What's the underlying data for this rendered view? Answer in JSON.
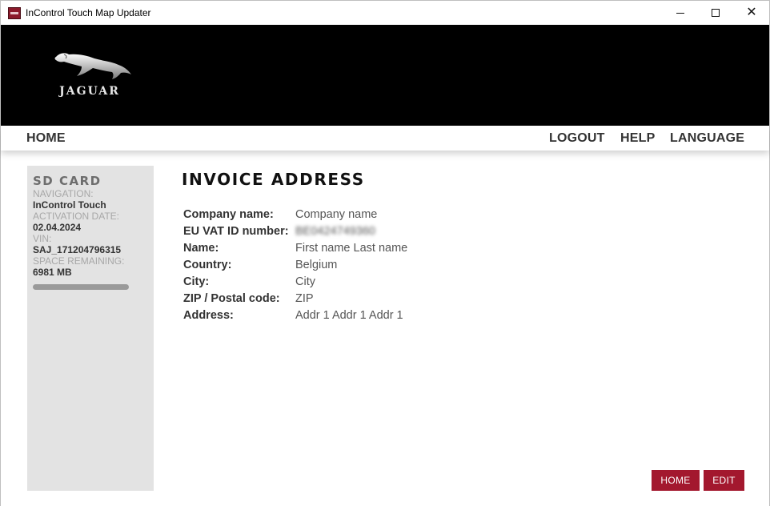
{
  "window": {
    "title": "InControl Touch Map Updater",
    "minimize_icon": "minimize-icon",
    "maximize_icon": "maximize-icon",
    "close_icon": "close-icon"
  },
  "brand": {
    "logo_text": "JAGUAR",
    "logo_icon": "jaguar-leaper-icon"
  },
  "nav": {
    "home": "HOME",
    "logout": "LOGOUT",
    "help": "HELP",
    "language": "LANGUAGE"
  },
  "sd_card": {
    "title": "SD CARD",
    "navigation_label": "NAVIGATION:",
    "navigation_value": "InControl Touch",
    "activation_label": "ACTIVATION DATE:",
    "activation_value": "02.04.2024",
    "vin_label": "VIN:",
    "vin_value": "SAJ_171204796315",
    "space_label": "SPACE REMAINING:",
    "space_value": "6981 MB"
  },
  "invoice": {
    "title": "INVOICE ADDRESS",
    "rows": [
      {
        "label": "Company name:",
        "value": "Company name"
      },
      {
        "label": "EU VAT ID number:",
        "value": "BE0424749360"
      },
      {
        "label": "Name:",
        "value": "First name Last name"
      },
      {
        "label": "Country:",
        "value": "Belgium"
      },
      {
        "label": "City:",
        "value": "City"
      },
      {
        "label": "ZIP / Postal code:",
        "value": "ZIP"
      },
      {
        "label": "Address:",
        "value": "Addr 1 Addr 1 Addr 1"
      }
    ]
  },
  "actions": {
    "home": "HOME",
    "edit": "EDIT"
  },
  "colors": {
    "accent": "#a3182e",
    "banner": "#000000",
    "sidebar": "#e3e3e3"
  }
}
